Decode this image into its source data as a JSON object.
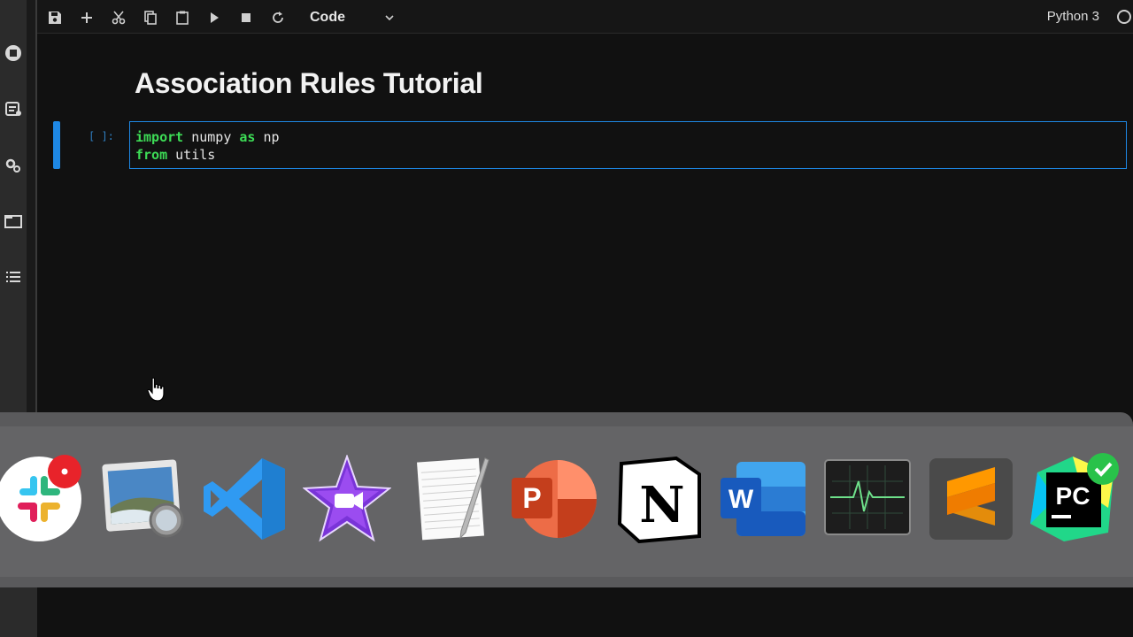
{
  "toolbar": {
    "cell_type": "Code",
    "kernel_name": "Python 3",
    "buttons": [
      "save-icon",
      "add-icon",
      "cut-icon",
      "copy-icon",
      "paste-icon",
      "run-icon",
      "stop-icon",
      "restart-icon"
    ]
  },
  "sidebar": {
    "items": [
      "running-icon",
      "commands-icon",
      "settings-icon",
      "tabs-icon",
      "toc-icon"
    ]
  },
  "notebook": {
    "heading": "Association Rules Tutorial",
    "cell": {
      "prompt": "[ ]:",
      "lines": [
        {
          "kw1": "import",
          "t1": " numpy ",
          "kw2": "as",
          "t2": " np"
        },
        {
          "kw1": "from",
          "t1": " utils",
          "kw2": "",
          "t2": ""
        }
      ]
    }
  },
  "dock": {
    "apps": [
      "slack",
      "preview",
      "visual-studio-code",
      "imovie",
      "textedit",
      "powerpoint",
      "notion",
      "word",
      "activity-monitor",
      "sublime-text",
      "pycharm"
    ],
    "colors": {
      "vscode": "#2f9af2",
      "imovie": "#8a2be2",
      "powerpoint": "#d24726",
      "word": "#2b579a",
      "sublime": "#ff9800",
      "pycharm": "#21d789"
    }
  },
  "accent": "#1e88e5"
}
